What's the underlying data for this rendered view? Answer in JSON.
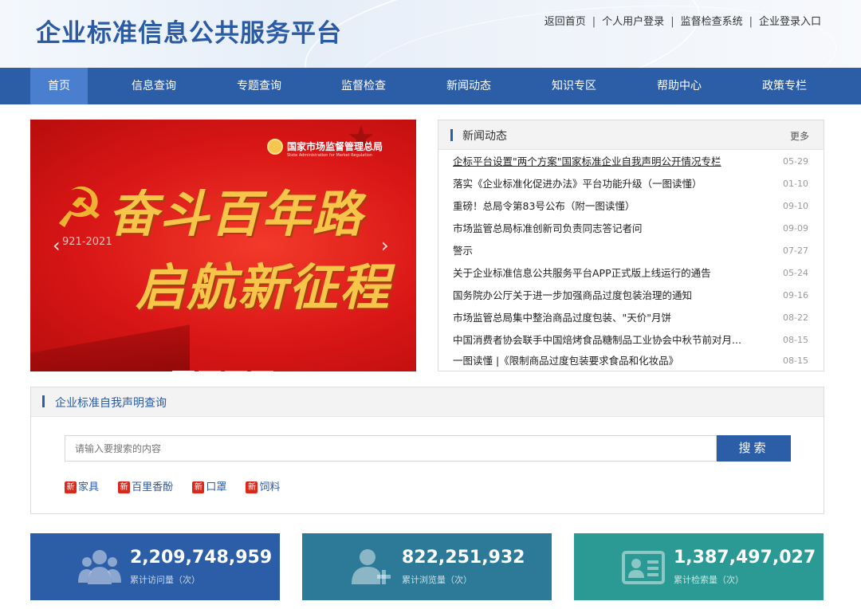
{
  "header": {
    "site_title": "企业标准信息公共服务平台",
    "links": [
      "返回首页",
      "个人用户登录",
      "监督检查系统",
      "企业登录入口"
    ]
  },
  "nav": {
    "items": [
      "首页",
      "信息查询",
      "专题查询",
      "监督检查",
      "新闻动态",
      "知识专区",
      "帮助中心",
      "政策专栏"
    ],
    "active": "首页"
  },
  "carousel": {
    "logo_text": "国家市场监督管理总局",
    "logo_sub": "State Administration for Market Regulation",
    "headline_1": "奋斗百年路",
    "headline_2": "启航新征程",
    "years": "921-2021"
  },
  "news": {
    "title": "新闻动态",
    "more": "更多",
    "items": [
      {
        "title": "企标平台设置\"两个方案\"国家标准企业自我声明公开情况专栏",
        "date": "05-29"
      },
      {
        "title": "落实《企业标准化促进办法》平台功能升级（一图读懂）",
        "date": "01-10"
      },
      {
        "title": "重磅！总局令第83号公布（附一图读懂）",
        "date": "09-10"
      },
      {
        "title": "市场监管总局标准创新司负责同志答记者问",
        "date": "09-09"
      },
      {
        "title": "警示",
        "date": "07-27"
      },
      {
        "title": "关于企业标准信息公共服务平台APP正式版上线运行的通告",
        "date": "05-24"
      },
      {
        "title": "国务院办公厅关于进一步加强商品过度包装治理的通知",
        "date": "09-16"
      },
      {
        "title": "市场监管总局集中整治商品过度包装、\"天价\"月饼",
        "date": "08-22"
      },
      {
        "title": "中国消费者协会联手中国焙烤食品糖制品工业协会中秋节前对月...",
        "date": "08-15"
      },
      {
        "title": "一图读懂 |《限制商品过度包装要求食品和化妆品》",
        "date": "08-15"
      }
    ]
  },
  "search": {
    "title": "企业标准自我声明查询",
    "placeholder": "请输入要搜索的内容",
    "button": "搜索",
    "new_badge": "新",
    "tags": [
      "家具",
      "百里香酚",
      "口罩",
      "饲料"
    ]
  },
  "stats": [
    {
      "value": "2,209,748,959",
      "label": "累计访问量（次）",
      "icon": "users-icon",
      "color": "#2c5ea8"
    },
    {
      "value": "822,251,932",
      "label": "累计浏览量（次）",
      "icon": "add-user-icon",
      "color": "#2d7a98"
    },
    {
      "value": "1,387,497,027",
      "label": "累计检索量（次）",
      "icon": "id-card-icon",
      "color": "#2b9a95"
    }
  ],
  "colors": {
    "nav": "#2c5ea8",
    "nav_active": "#4a7fcf",
    "badge": "#d9291c"
  }
}
